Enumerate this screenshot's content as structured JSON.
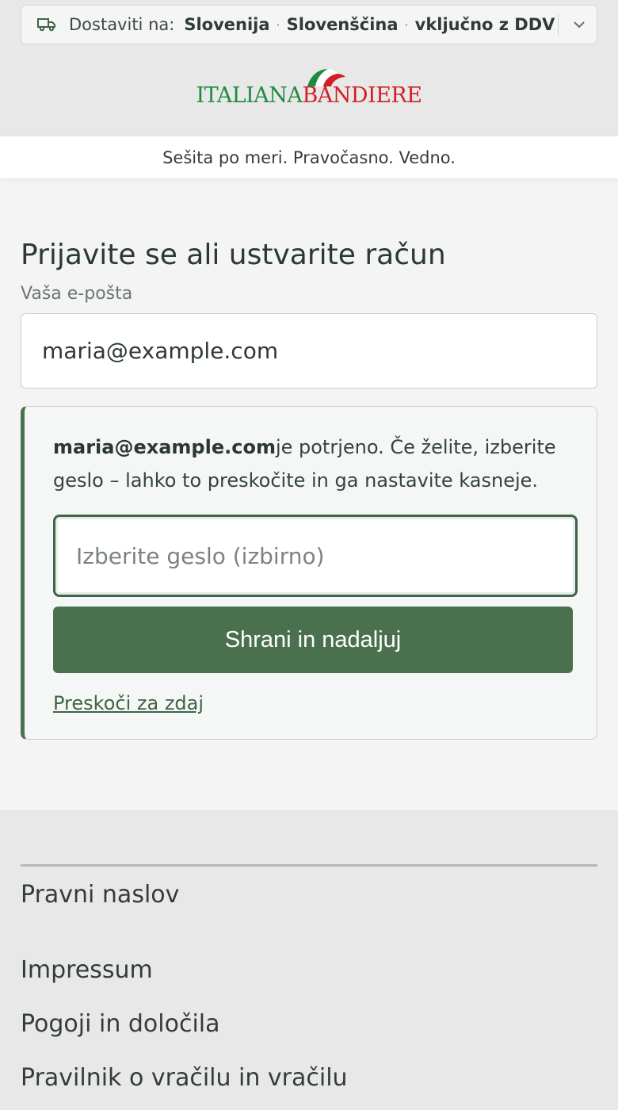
{
  "shipping": {
    "label": "Dostaviti na:",
    "country": "Slovenija",
    "language": "Slovenščina",
    "tax": "vključno z DDV",
    "dot": "·"
  },
  "brand": {
    "name_green": "ITALIANA",
    "name_red": "BANDIERE",
    "colors": {
      "green": "#1e8c3e",
      "red": "#d11f26"
    }
  },
  "tagline": "Sešita po meri. Pravočasno. Vedno.",
  "login": {
    "title": "Prijavite se ali ustvarite račun",
    "email_label": "Vaša e-pošta",
    "email_value": "maria@example.com",
    "confirm_email": "maria@example.com",
    "confirm_text": "je potrjeno. Če želite, izberite geslo – lahko to preskočite in ga nastavite kasneje.",
    "password_placeholder": "Izberite geslo (izbirno)",
    "save_button": "Shrani in nadaljuj",
    "skip_link": "Preskoči za zdaj"
  },
  "footer": {
    "heading": "Pravni naslov",
    "links": [
      "Impressum",
      "Pogoji in določila",
      "Pravilnik o vračilu in vračilu"
    ]
  },
  "icons": {
    "shipping": "truck-icon",
    "dropdown": "chevron-down-icon"
  },
  "accent_color": "#4a704e"
}
